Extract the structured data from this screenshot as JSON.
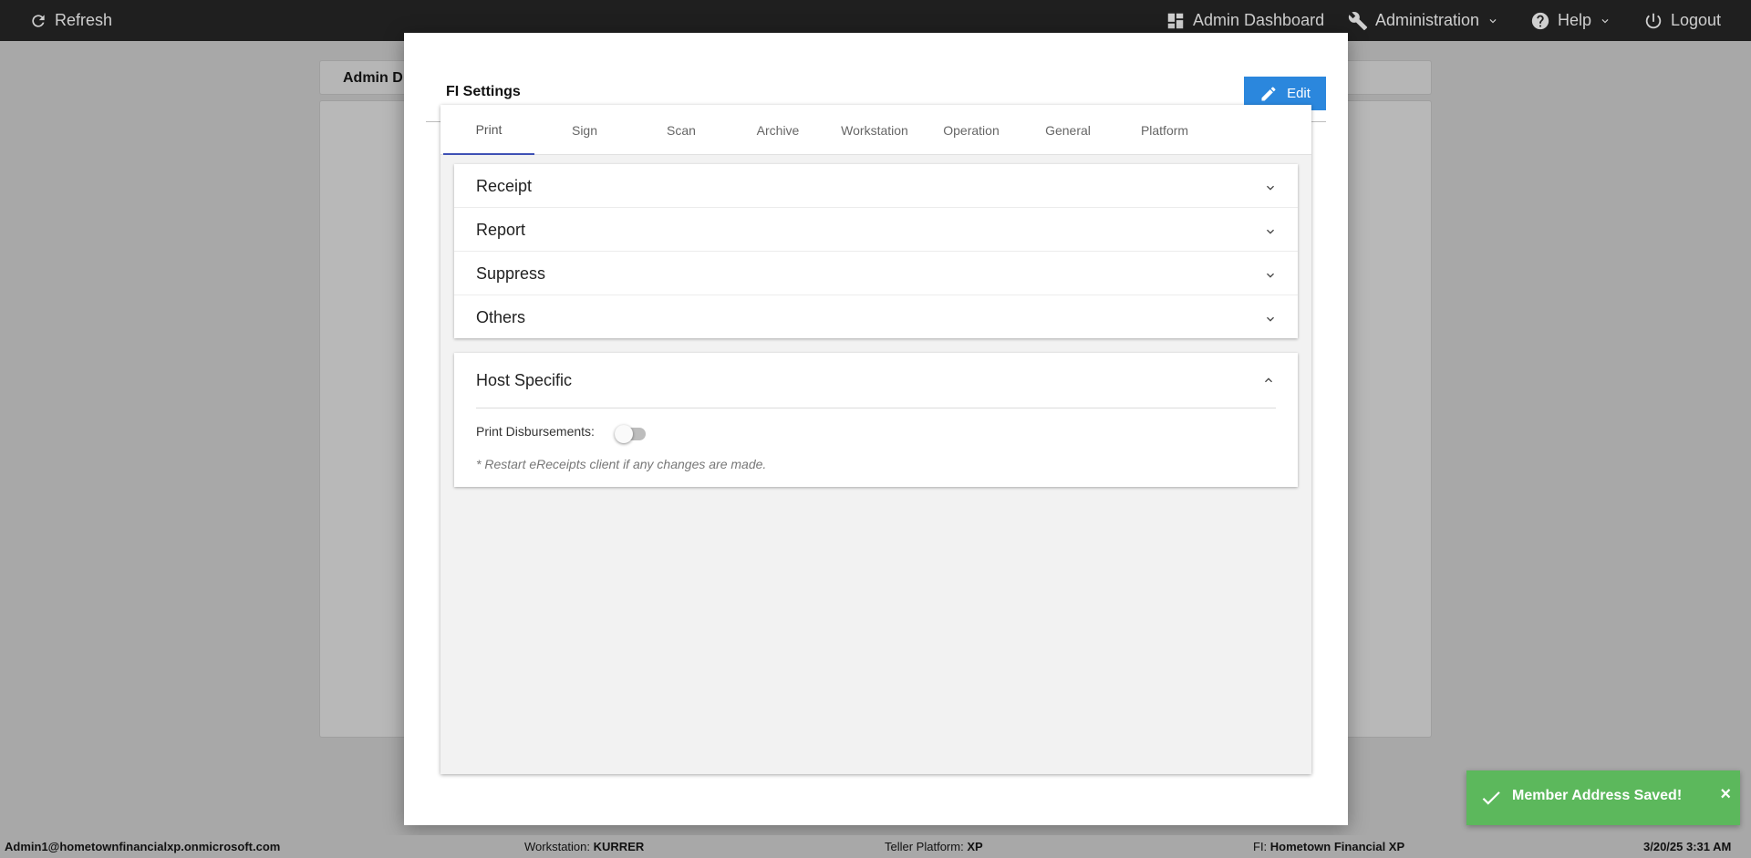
{
  "topbar": {
    "refresh_label": "Refresh",
    "admin_dashboard_label": "Admin Dashboard",
    "administration_label": "Administration",
    "help_label": "Help",
    "logout_label": "Logout"
  },
  "background": {
    "header_title": "Admin D"
  },
  "modal": {
    "title": "FI Settings",
    "edit_label": "Edit",
    "tabs": [
      {
        "label": "Print",
        "active": true
      },
      {
        "label": "Sign"
      },
      {
        "label": "Scan"
      },
      {
        "label": "Archive"
      },
      {
        "label": "Workstation"
      },
      {
        "label": "Operation"
      },
      {
        "label": "General"
      },
      {
        "label": "Platform"
      }
    ],
    "accordion": [
      "Receipt",
      "Report",
      "Suppress",
      "Others"
    ],
    "host_specific": {
      "title": "Host Specific",
      "print_disbursements_label": "Print Disbursements:",
      "print_disbursements_on": false,
      "note": "* Restart eReceipts client if any changes are made."
    }
  },
  "toast": {
    "message": "Member Address Saved!",
    "close": "×"
  },
  "footer": {
    "user": "Admin1@hometownfinancialxp.onmicrosoft.com",
    "workstation_label": "Workstation:",
    "workstation_value": "KURRER",
    "platform_label": "Teller Platform:",
    "platform_value": "XP",
    "fi_label": "FI:",
    "fi_value": "Hometown Financial XP",
    "datetime": "3/20/25 3:31 AM"
  },
  "colors": {
    "topbar": "#1f1f1f",
    "edit_button": "#2b87dd",
    "active_tab_underline": "#3f51b5",
    "toast": "#5cb85c"
  }
}
